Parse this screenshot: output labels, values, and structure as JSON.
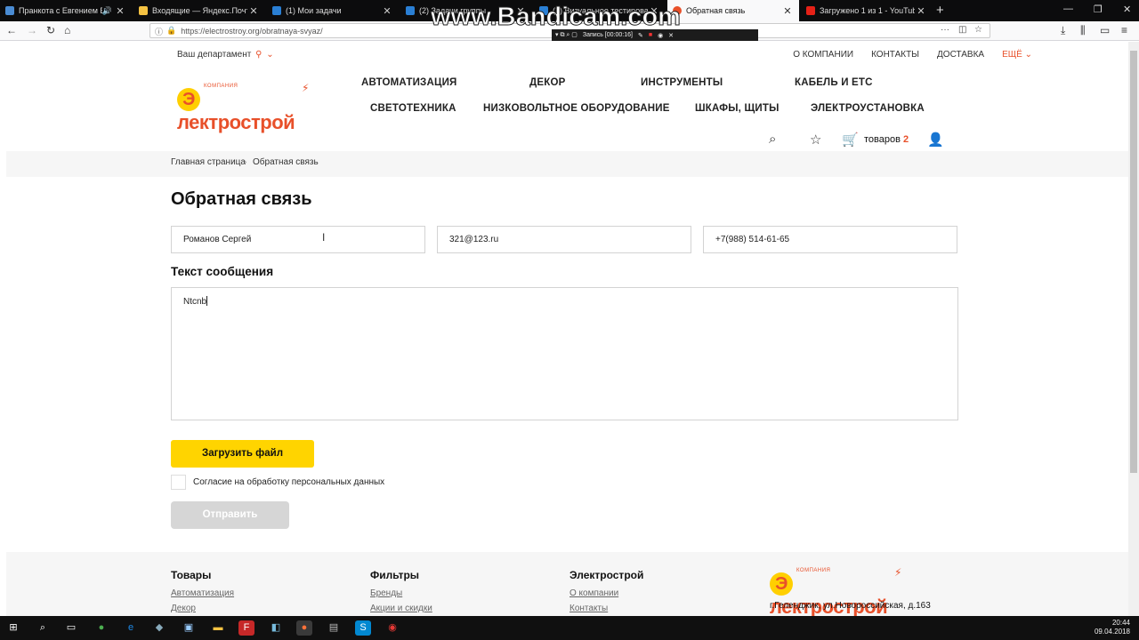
{
  "browser": {
    "tabs": [
      {
        "title": "Пранкота с Евгением Вольн",
        "color": "#4a8cd4",
        "audio": true
      },
      {
        "title": "Входящие — Яндекс.Почта",
        "color": "#f4c242"
      },
      {
        "title": "(1) Мои задачи",
        "color": "#2a7fd4"
      },
      {
        "title": "(2) Задачи группы",
        "color": "#2a7fd4"
      },
      {
        "title": "(2) Визуальное тестирование этапа",
        "color": "#2a7fd4"
      },
      {
        "title": "Обратная связь",
        "color": "#e8502a",
        "active": true
      },
      {
        "title": "Загружено 1 из 1 - YouTube",
        "color": "#e62117"
      }
    ],
    "new_tab": "+",
    "url": "https://electrostroy.org/obratnaya-svyaz/"
  },
  "recorder": {
    "watermark": "www.Bandicam.com",
    "status": "Запись [00:00:16]"
  },
  "header": {
    "department": "Ваш департамент",
    "top_links": [
      "О КОМПАНИИ",
      "КОНТАКТЫ",
      "ДОСТАВКА",
      "ЕЩЁ"
    ],
    "logo": {
      "small": "КОМПАНИЯ",
      "big": "Электрострой"
    },
    "menu_row1": [
      "АВТОМАТИЗАЦИЯ",
      "ДЕКОР",
      "ИНСТРУМЕНТЫ",
      "КАБЕЛЬ И ETC"
    ],
    "menu_row2": [
      "СВЕТОТЕХНИКА",
      "НИЗКОВОЛЬТНОЕ ОБОРУДОВАНИЕ",
      "ШКАФЫ, ЩИТЫ",
      "ЭЛЕКТРОУСТАНОВКА"
    ],
    "cart_label": "товаров",
    "cart_count": "2"
  },
  "breadcrumbs": [
    "Главная страница",
    "Обратная связь"
  ],
  "form": {
    "title": "Обратная связь",
    "name_value": "Романов Сергей",
    "email_value": "321@123.ru",
    "phone_value": "+7(988) 514-61-65",
    "message_label": "Текст сообщения",
    "message_value": "Ntcnb",
    "upload_label": "Загрузить файл",
    "consent_label": "Согласие на обработку персональных данных",
    "consent_checked": false,
    "submit_label": "Отправить"
  },
  "footer": {
    "col1": {
      "title": "Товары",
      "links": [
        "Автоматизация",
        "Декор"
      ]
    },
    "col2": {
      "title": "Фильтры",
      "links": [
        "Бренды",
        "Акции и скидки"
      ]
    },
    "col3": {
      "title": "Электрострой",
      "links": [
        "О компании",
        "Контакты"
      ]
    },
    "address": "г.Геленджик, ул.Новороссийская, д.163"
  },
  "taskbar": {
    "time": "20:44",
    "date": "09.04.2018"
  },
  "colors": {
    "accent": "#e8502a",
    "button_yellow": "#ffd400",
    "button_disabled": "#d6d6d6"
  }
}
